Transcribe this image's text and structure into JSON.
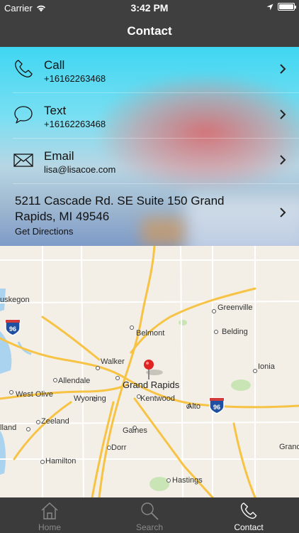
{
  "status_bar": {
    "carrier": "Carrier",
    "time": "3:42 PM",
    "icons": [
      "wifi-icon",
      "location-arrow-icon",
      "battery-icon"
    ]
  },
  "nav": {
    "title": "Contact"
  },
  "contact": {
    "rows": [
      {
        "label": "Call",
        "value": "+16162263468",
        "icon": "phone-icon"
      },
      {
        "label": "Text",
        "value": "+16162263468",
        "icon": "speech-bubble-icon"
      },
      {
        "label": "Email",
        "value": "lisa@lisacoe.com",
        "icon": "envelope-icon"
      }
    ],
    "address": {
      "line": "5211 Cascade Rd. SE Suite 150 Grand Rapids, MI 49546",
      "action": "Get Directions"
    }
  },
  "map": {
    "places": [
      "uskegon",
      "Greenville",
      "Belmont",
      "Belding",
      "Walker",
      "Ionia",
      "Allendale",
      "Grand Rapids",
      "West Olive",
      "Wyoming",
      "Kentwood",
      "Alto",
      "Zeeland",
      "lland",
      "Gaines",
      "Dorr",
      "Grand",
      "Hamilton",
      "Hastings"
    ],
    "shields": [
      "96",
      "96"
    ],
    "pin_color": "#e02424"
  },
  "tabs": [
    {
      "label": "Home",
      "icon": "home-icon",
      "active": false
    },
    {
      "label": "Search",
      "icon": "search-icon",
      "active": false
    },
    {
      "label": "Contact",
      "icon": "phone-icon",
      "active": true
    }
  ],
  "colors": {
    "bar_background": "#3f3f3f",
    "tab_active": "#ffffff",
    "tab_inactive": "#8a8a8a"
  }
}
